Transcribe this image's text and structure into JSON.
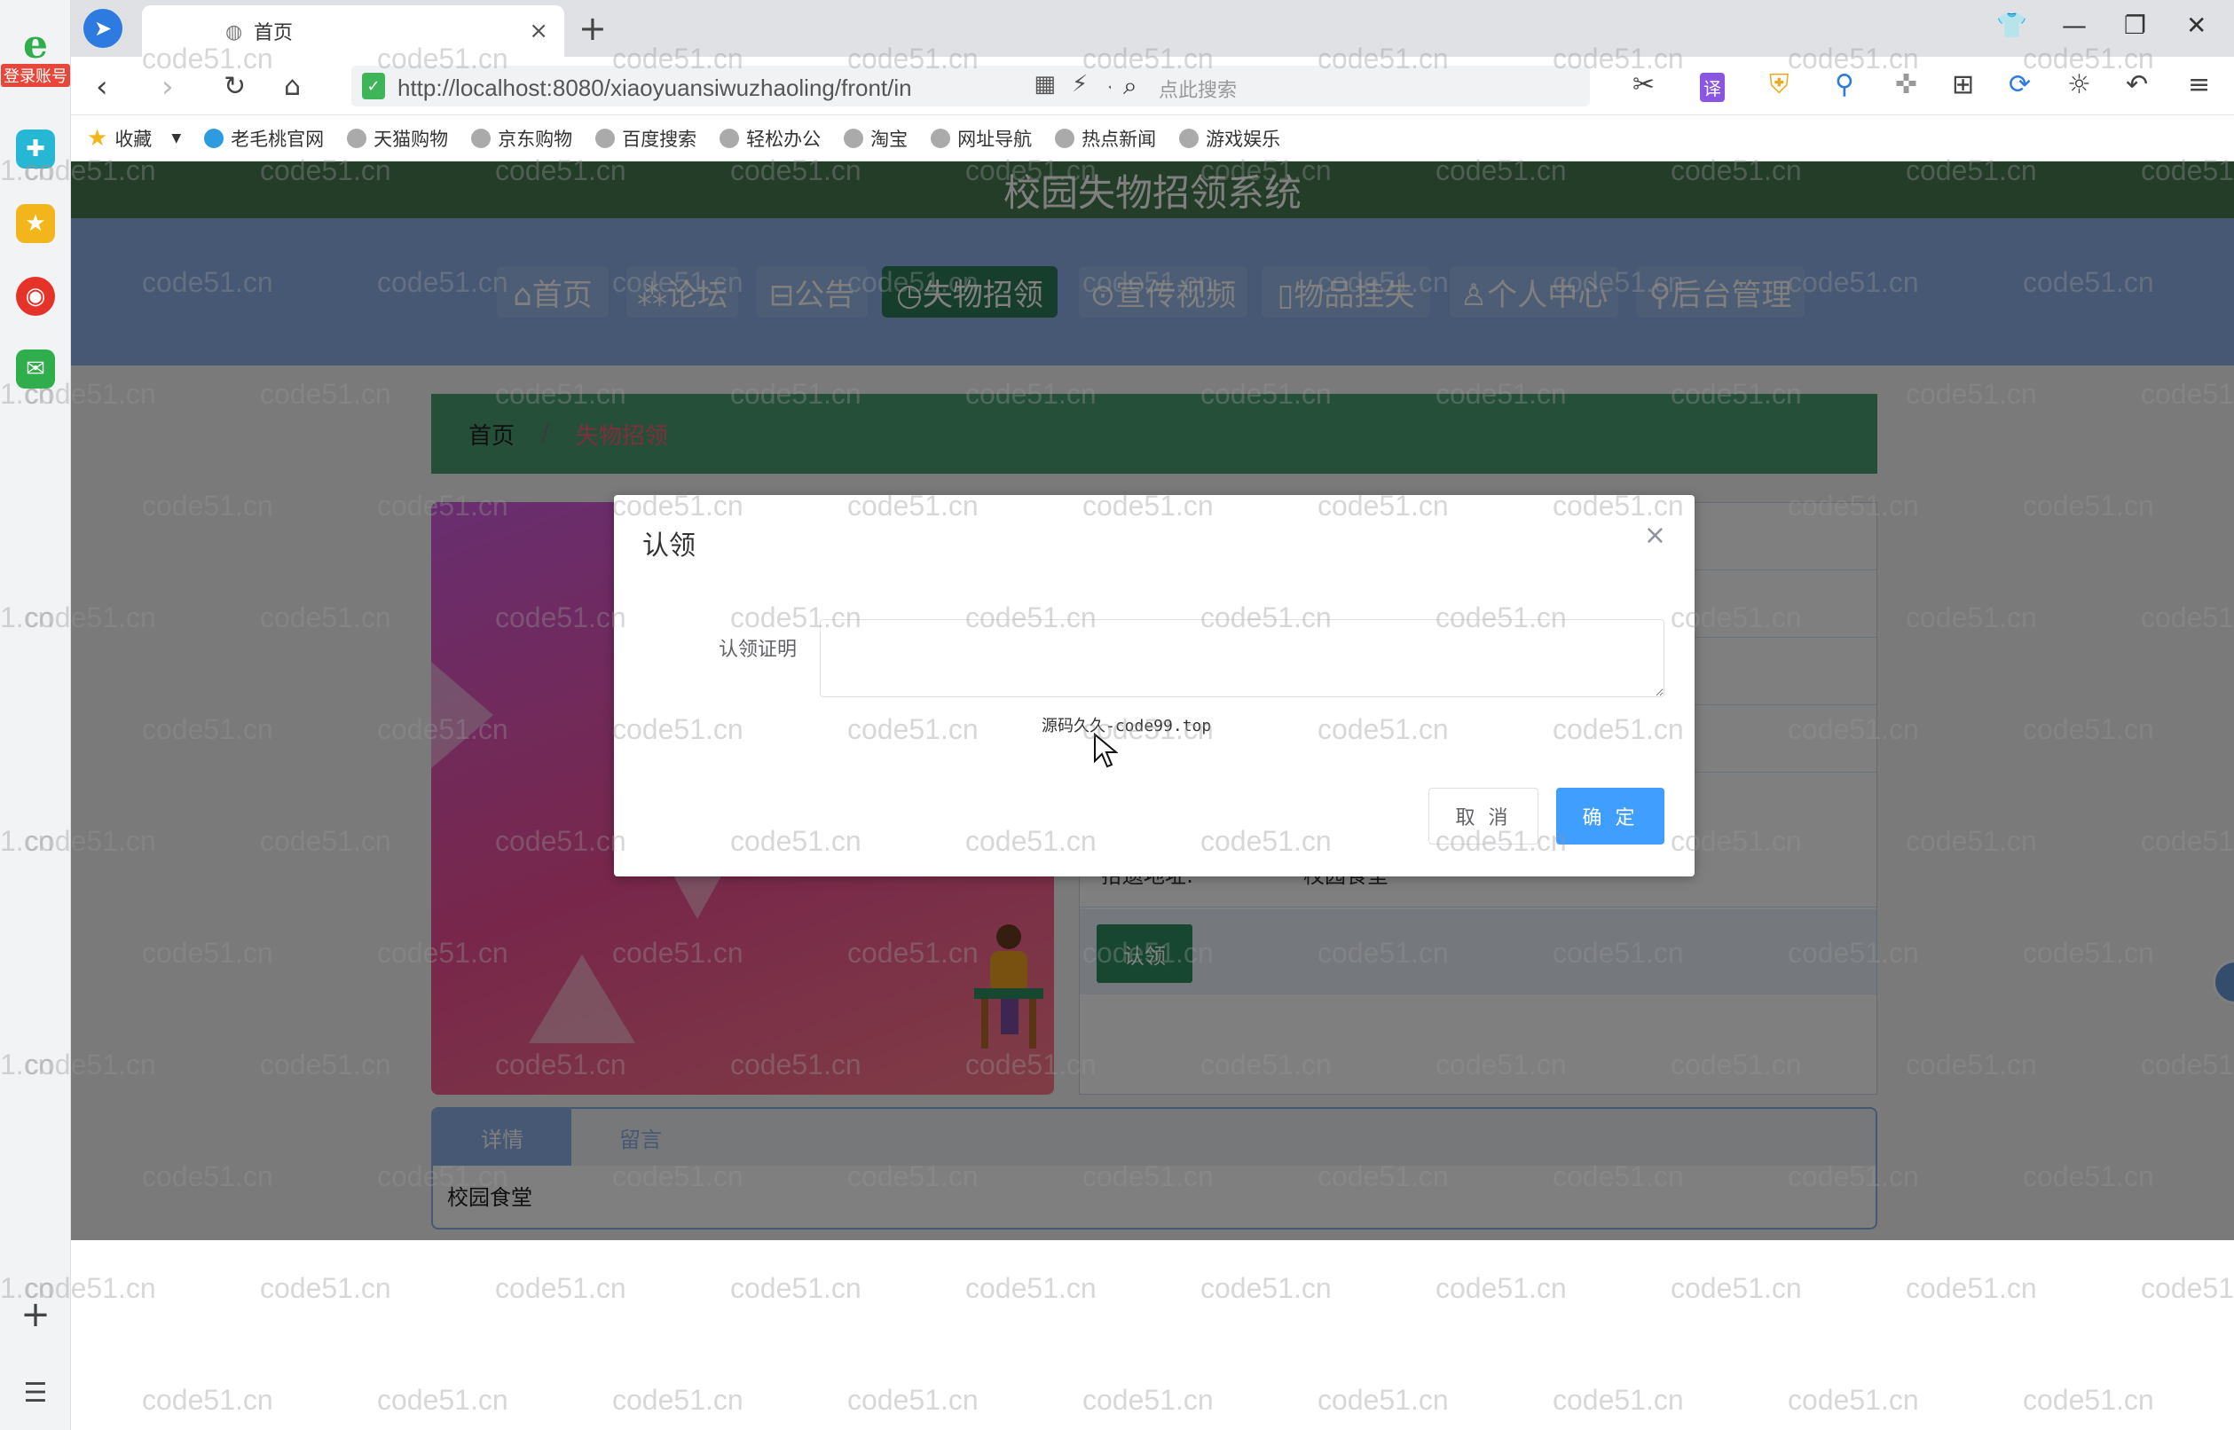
{
  "sidebar": {
    "login_badge": "登录账号"
  },
  "browser": {
    "tab_title": "首页",
    "url": "http://localhost:8080/xiaoyuansiwuzhaoling/front/in",
    "search_placeholder": "点此搜索",
    "translate_label": "译"
  },
  "bookmarks": {
    "favorites_label": "收藏",
    "items": [
      "老毛桃官网",
      "天猫购物",
      "京东购物",
      "百度搜索",
      "轻松办公",
      "淘宝",
      "网址导航",
      "热点新闻",
      "游戏娱乐"
    ]
  },
  "site": {
    "title": "校园失物招领系统",
    "nav": [
      {
        "label": "⌂首页"
      },
      {
        "label": "⁂论坛"
      },
      {
        "label": "⊟公告"
      },
      {
        "label": "◷失物招领"
      },
      {
        "label": "⊙宣传视频"
      },
      {
        "label": "▯物品挂失"
      },
      {
        "label": "♙个人中心"
      },
      {
        "label": "⚲后台管理"
      }
    ],
    "breadcrumb": {
      "home": "首页",
      "separator": "/",
      "current": "失物招领"
    },
    "info": {
      "pickup_address_label": "拾遗地址:",
      "pickup_address_value": "校园食堂"
    },
    "claim_button": "认领",
    "tabs": {
      "detail": "详情",
      "messages": "留言",
      "content": "校园食堂"
    }
  },
  "modal": {
    "title": "认领",
    "close_symbol": "×",
    "field_label": "认领证明",
    "field_value": "",
    "note": "源码久久-code99.top",
    "cancel_label": "取 消",
    "ok_label": "确 定"
  },
  "watermark": {
    "text": "code51.cn",
    "partial": "1.cn"
  },
  "colors": {
    "header_green": "#477a52",
    "nav_blue": "#8db1e8",
    "active_nav": "#2f7a58",
    "primary_button": "#409eff"
  }
}
